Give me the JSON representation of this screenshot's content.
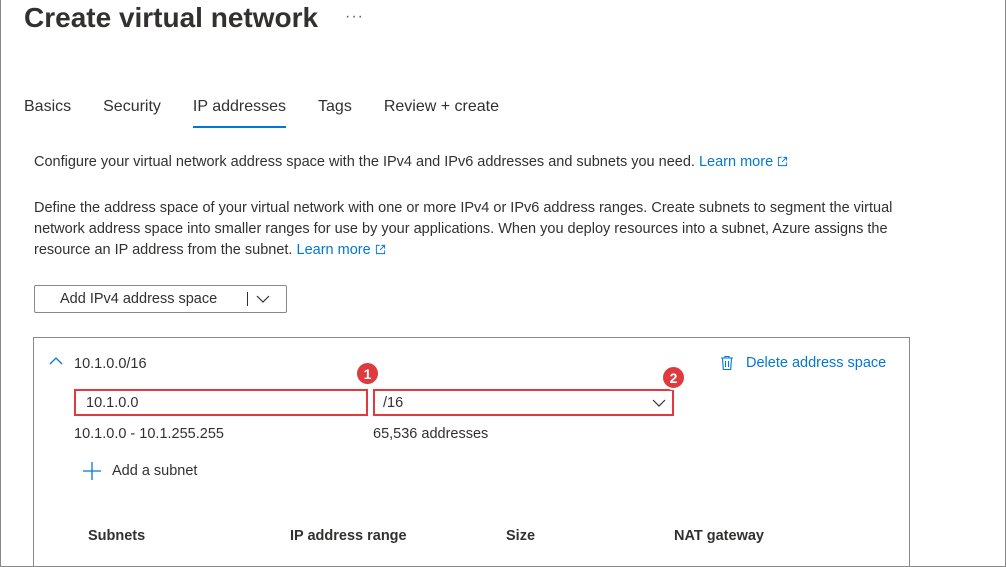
{
  "page": {
    "title": "Create virtual network",
    "more_label": "···"
  },
  "tabs": [
    {
      "label": "Basics"
    },
    {
      "label": "Security"
    },
    {
      "label": "IP addresses"
    },
    {
      "label": "Tags"
    },
    {
      "label": "Review + create"
    }
  ],
  "active_tab": "IP addresses",
  "intro": {
    "text": "Configure your virtual network address space with the IPv4 and IPv6 addresses and subnets you need.",
    "link": "Learn more"
  },
  "description": {
    "text": "Define the address space of your virtual network with one or more IPv4 or IPv6 address ranges. Create subnets to segment the virtual network address space into smaller ranges for use by your applications. When you deploy resources into a subnet, Azure assigns the resource an IP address from the subnet.",
    "link": "Learn more"
  },
  "add_space_button": {
    "label": "Add IPv4 address space"
  },
  "address_space": {
    "title": "10.1.0.0/16",
    "delete_label": "Delete address space",
    "address_value": "10.1.0.0",
    "prefix_value": "/16",
    "range": "10.1.0.0 - 10.1.255.255",
    "count": "65,536 addresses",
    "add_subnet_label": "Add a subnet",
    "callouts": [
      "1",
      "2"
    ],
    "table_headers": [
      "Subnets",
      "IP address range",
      "Size",
      "NAT gateway"
    ]
  },
  "colors": {
    "accent": "#0078d4",
    "callout": "#e0393e",
    "text": "#323130"
  }
}
